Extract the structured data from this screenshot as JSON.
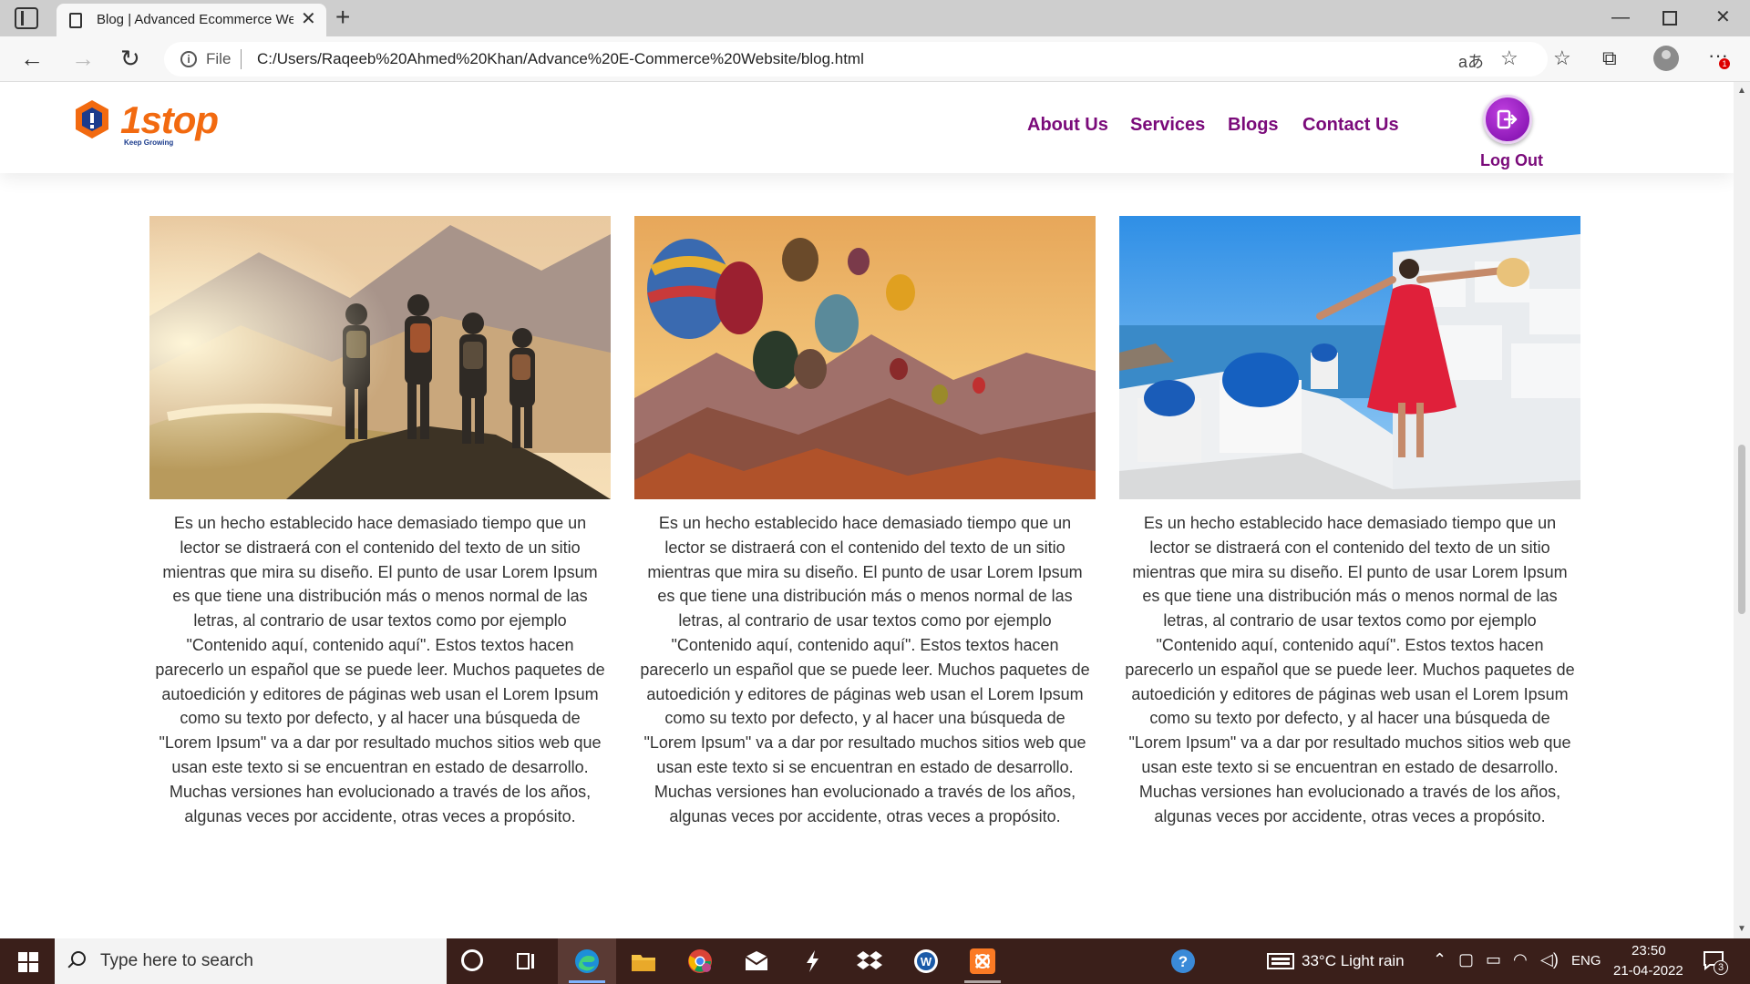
{
  "browser": {
    "tab_title": "Blog | Advanced Ecommerce Website",
    "omnibox_label": "File",
    "url": "C:/Users/Raqeeb%20Ahmed%20Khan/Advance%20E-Commerce%20Website/blog.html",
    "notification_badge": "1"
  },
  "site": {
    "logo_text": "1stop",
    "logo_tagline": "Keep Growing",
    "nav": [
      "About Us",
      "Services",
      "Blogs",
      "Contact Us"
    ],
    "logout_label": "Log Out",
    "accent_color": "#7a0a7a"
  },
  "cards": [
    {
      "image": "hikers-mountain-sunset",
      "text": "Es un hecho establecido hace demasiado tiempo que un lector se distraerá con el contenido del texto de un sitio mientras que mira su diseño. El punto de usar Lorem Ipsum es que tiene una distribución más o menos normal de las letras, al contrario de usar textos como por ejemplo \"Contenido aquí, contenido aquí\". Estos textos hacen parecerlo un español que se puede leer. Muchos paquetes de autoedición y editores de páginas web usan el Lorem Ipsum como su texto por defecto, y al hacer una búsqueda de \"Lorem Ipsum\" va a dar por resultado muchos sitios web que usan este texto si se encuentran en estado de desarrollo. Muchas versiones han evolucionado a través de los años, algunas veces por accidente, otras veces a propósito."
    },
    {
      "image": "hot-air-balloons",
      "text": "Es un hecho establecido hace demasiado tiempo que un lector se distraerá con el contenido del texto de un sitio mientras que mira su diseño. El punto de usar Lorem Ipsum es que tiene una distribución más o menos normal de las letras, al contrario de usar textos como por ejemplo \"Contenido aquí, contenido aquí\". Estos textos hacen parecerlo un español que se puede leer. Muchos paquetes de autoedición y editores de páginas web usan el Lorem Ipsum como su texto por defecto, y al hacer una búsqueda de \"Lorem Ipsum\" va a dar por resultado muchos sitios web que usan este texto si se encuentran en estado de desarrollo. Muchas versiones han evolucionado a través de los años, algunas veces por accidente, otras veces a propósito."
    },
    {
      "image": "woman-red-dress-santorini",
      "text": "Es un hecho establecido hace demasiado tiempo que un lector se distraerá con el contenido del texto de un sitio mientras que mira su diseño. El punto de usar Lorem Ipsum es que tiene una distribución más o menos normal de las letras, al contrario de usar textos como por ejemplo \"Contenido aquí, contenido aquí\". Estos textos hacen parecerlo un español que se puede leer. Muchos paquetes de autoedición y editores de páginas web usan el Lorem Ipsum como su texto por defecto, y al hacer una búsqueda de \"Lorem Ipsum\" va a dar por resultado muchos sitios web que usan este texto si se encuentran en estado de desarrollo. Muchas versiones han evolucionado a través de los años, algunas veces por accidente, otras veces a propósito."
    }
  ],
  "taskbar": {
    "search_placeholder": "Type here to search",
    "weather": "33°C  Light rain",
    "language": "ENG",
    "time": "23:50",
    "date": "21-04-2022",
    "notification_count": "3"
  }
}
